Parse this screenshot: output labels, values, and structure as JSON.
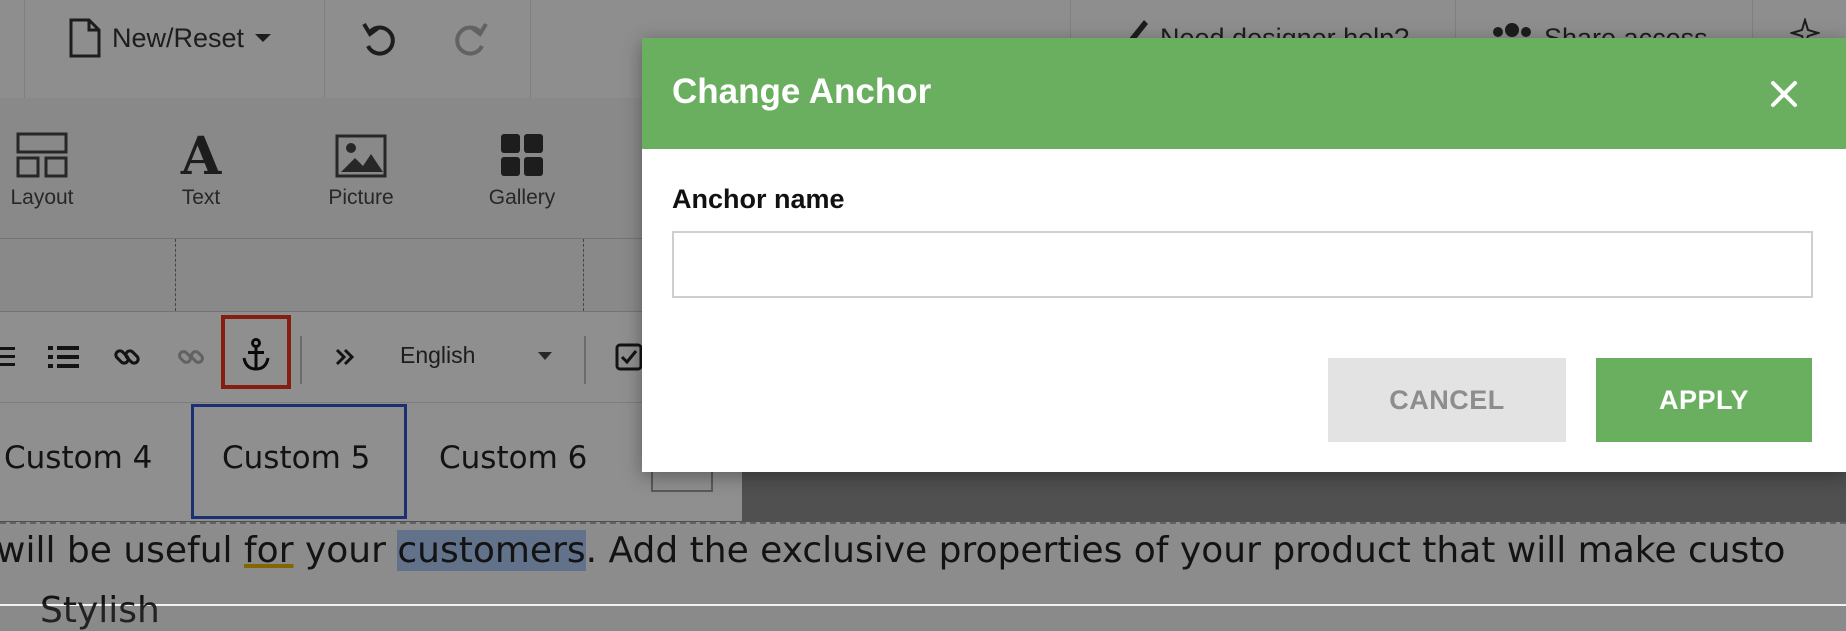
{
  "topbar": {
    "new_reset_label": "New/Reset",
    "designer_help_label": "Need designer help?",
    "share_access_label": "Share access"
  },
  "palette": {
    "items": [
      {
        "label": "Layout",
        "icon": "layout-icon"
      },
      {
        "label": "Text",
        "icon": "text-icon"
      },
      {
        "label": "Picture",
        "icon": "picture-icon"
      },
      {
        "label": "Gallery",
        "icon": "gallery-icon"
      }
    ]
  },
  "format_toolbar": {
    "language": "English",
    "icons": [
      "align-icon",
      "bulleted-list-icon",
      "link-icon",
      "unlink-icon",
      "anchor-icon",
      "more-icon",
      "checkbox-icon"
    ]
  },
  "tabs": [
    {
      "label": "Custom 4"
    },
    {
      "label": "Custom 5",
      "active": true
    },
    {
      "label": "Custom 6"
    }
  ],
  "content": {
    "text_part1": "will be useful ",
    "text_for": "for",
    "text_part2": " your ",
    "text_selected": "customers",
    "text_part3": ". Add the exclusive properties of your product that will make custo",
    "text_line2": "Stylish"
  },
  "dialog": {
    "title": "Change Anchor",
    "field_label": "Anchor name",
    "field_value": "",
    "field_placeholder": "",
    "cancel_label": "CANCEL",
    "apply_label": "APPLY"
  },
  "colors": {
    "accent_green": "#6aaf5f",
    "highlight_red": "#e5321e",
    "active_tab_blue": "#2c53c4"
  }
}
